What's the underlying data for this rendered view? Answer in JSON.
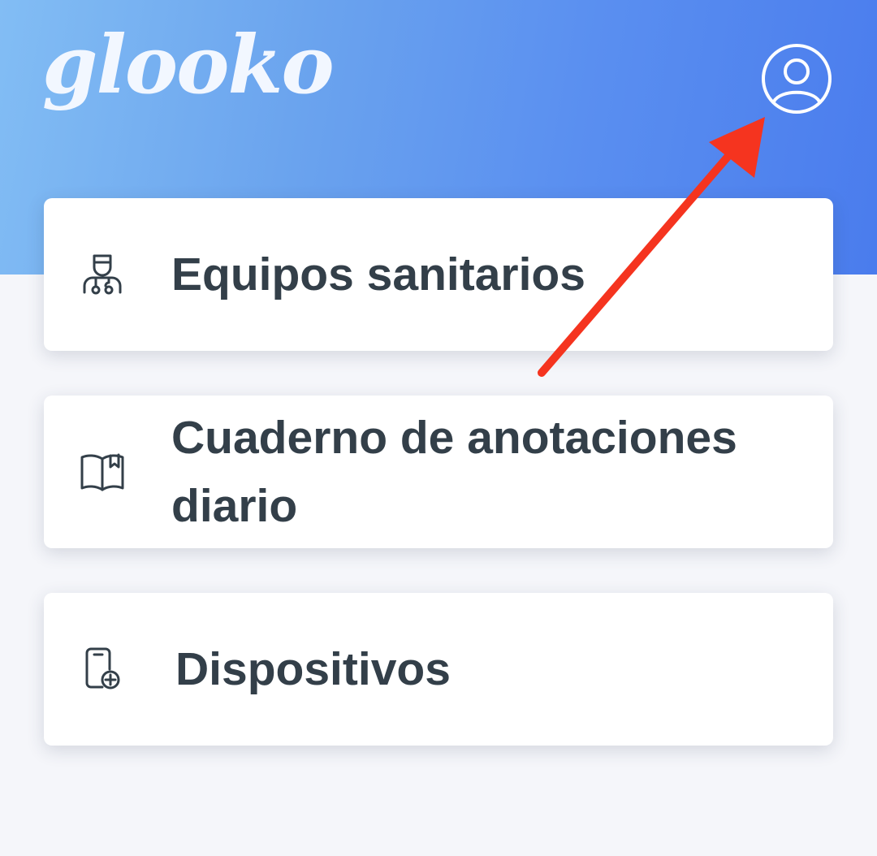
{
  "header": {
    "logo_text": "glooko",
    "profile_icon": "user-circle-icon",
    "colors": {
      "gradient_start": "#82bdf4",
      "gradient_end": "#4a7ced",
      "logo": "#f2f7ff"
    }
  },
  "menu": {
    "items": [
      {
        "label": "Equipos sanitarios",
        "icon": "doctor-icon"
      },
      {
        "label": "Cuaderno de anotaciones diario",
        "icon": "book-icon"
      },
      {
        "label": "Dispositivos",
        "icon": "device-plus-icon"
      }
    ]
  },
  "annotation": {
    "type": "arrow",
    "color": "#f5341f",
    "points_to": "profile-button"
  },
  "colors": {
    "page_background": "#f5f6fa",
    "card_background": "#ffffff",
    "text": "#333f49"
  }
}
